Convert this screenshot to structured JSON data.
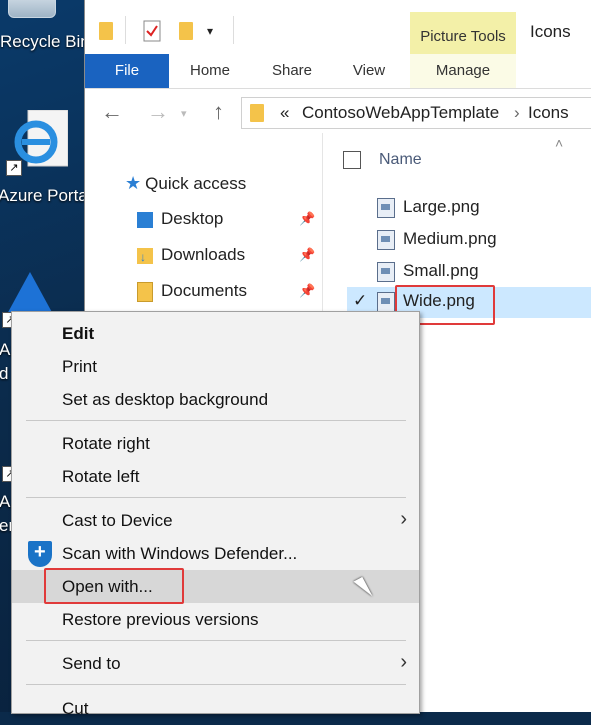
{
  "desktop": {
    "icons": [
      {
        "label": "Recycle Bin"
      },
      {
        "label": "Azure Porta"
      },
      {
        "label": "Az"
      },
      {
        "label": "d"
      },
      {
        "label": "Az"
      },
      {
        "label": "er"
      }
    ]
  },
  "explorer": {
    "title": "Icons",
    "contextual_tab_group": "Picture Tools",
    "tabs": [
      {
        "label": "File"
      },
      {
        "label": "Home"
      },
      {
        "label": "Share"
      },
      {
        "label": "View"
      },
      {
        "label": "Manage"
      }
    ],
    "address": {
      "prefix": "«",
      "segments": [
        "ContosoWebAppTemplate",
        "Icons"
      ]
    },
    "nav_pane": {
      "quick_access": "Quick access",
      "items": [
        {
          "label": "Desktop"
        },
        {
          "label": "Downloads"
        },
        {
          "label": "Documents"
        }
      ]
    },
    "content": {
      "column_header": "Name",
      "files": [
        {
          "name": "Large.png"
        },
        {
          "name": "Medium.png"
        },
        {
          "name": "Small.png"
        },
        {
          "name": "Wide.png",
          "selected": true
        }
      ]
    }
  },
  "context_menu": {
    "items": [
      {
        "label": "Edit",
        "bold": true
      },
      {
        "label": "Print"
      },
      {
        "label": "Set as desktop background"
      },
      {
        "label": "Rotate right"
      },
      {
        "label": "Rotate left"
      },
      {
        "label": "Cast to Device",
        "submenu": true
      },
      {
        "label": "Scan with Windows Defender..."
      },
      {
        "label": "Open with...",
        "highlighted": true
      },
      {
        "label": "Restore previous versions"
      },
      {
        "label": "Send to",
        "submenu": true
      },
      {
        "label": "Cut"
      }
    ]
  },
  "colors": {
    "file_tab": "#1a63c0",
    "picture_tools": "#f3f0a8",
    "selection": "#cce8ff",
    "callout_red": "#e03a3a",
    "menu_hover": "#d7d7d7"
  }
}
